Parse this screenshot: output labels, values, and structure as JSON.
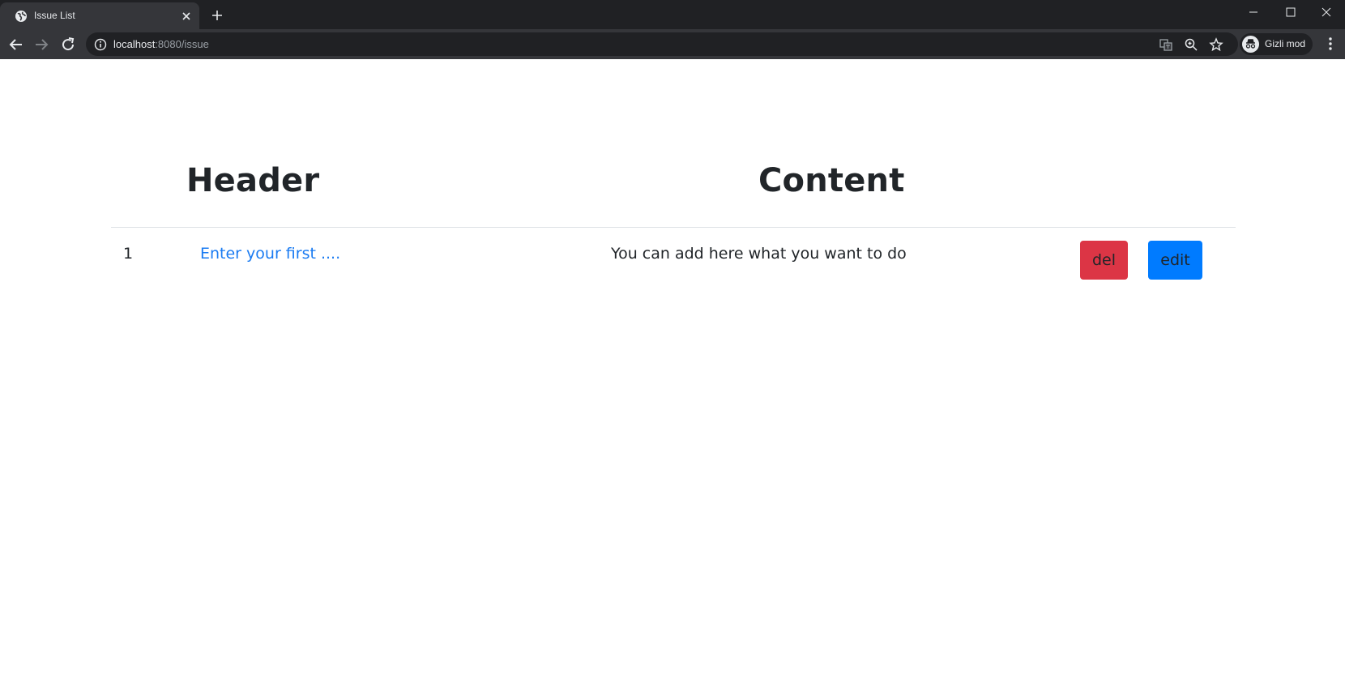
{
  "browser": {
    "tab_title": "Issue List",
    "url_host": "localhost",
    "url_rest": ":8080/issue",
    "profile_label": "Gizli mod"
  },
  "table": {
    "headers": [
      "Header",
      "Content"
    ],
    "rows": [
      {
        "index": "1",
        "header_link": "Enter your first ....",
        "content": "You can add here what you want to do",
        "del_label": "del",
        "edit_label": "edit"
      }
    ]
  },
  "colors": {
    "chrome_bg": "#202124",
    "toolbar_bg": "#35363a",
    "link": "#1a7bf2",
    "danger": "#dc3545",
    "primary": "#007bff"
  }
}
